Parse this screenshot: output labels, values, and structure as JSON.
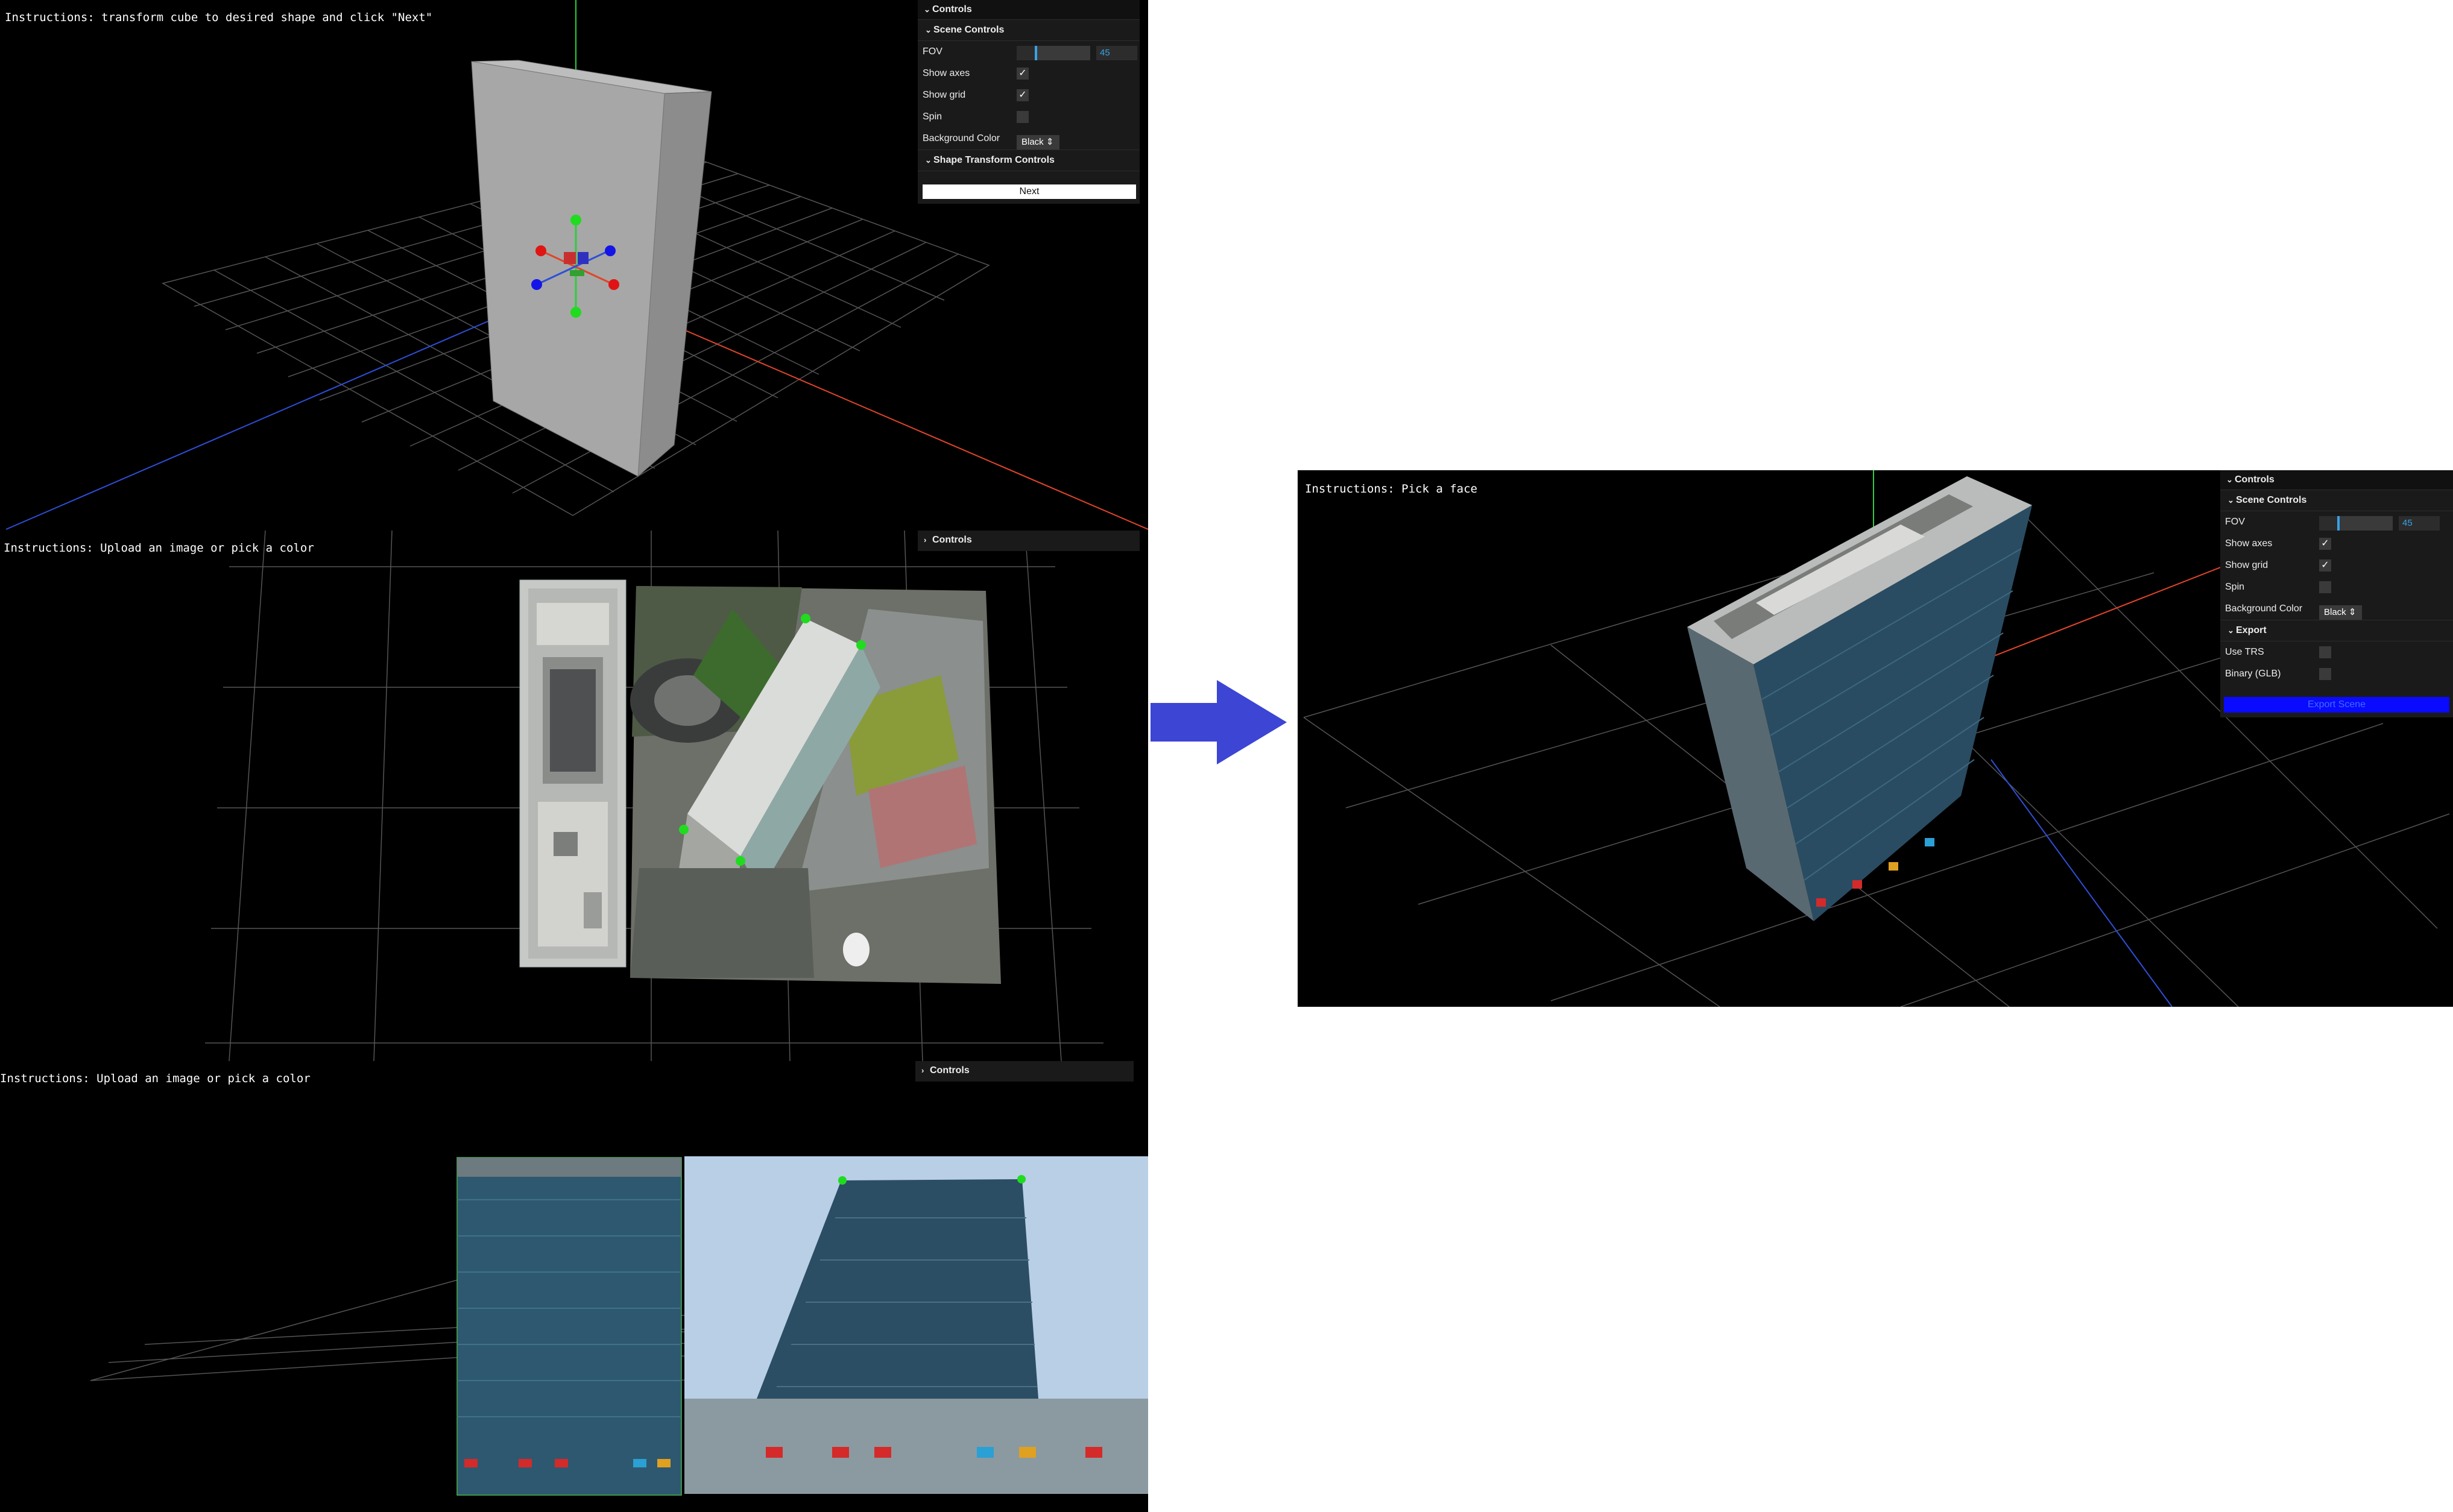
{
  "panels": {
    "transform": {
      "instructions": "Instructions: transform cube to desired shape and click \"Next\"",
      "controls": {
        "title": "Controls",
        "scene_title": "Scene Controls",
        "fov_label": "FOV",
        "fov_value": "45",
        "show_axes_label": "Show axes",
        "show_axes_checked": true,
        "show_grid_label": "Show grid",
        "show_grid_checked": true,
        "spin_label": "Spin",
        "spin_checked": false,
        "bg_label": "Background Color",
        "bg_value": "Black",
        "shape_title": "Shape Transform Controls",
        "next_label": "Next"
      }
    },
    "top_face": {
      "instructions": "Instructions: Upload an image or pick a color",
      "controls_title": "Controls"
    },
    "side_face": {
      "instructions": "Instructions: Upload an image or pick a color",
      "controls_title": "Controls"
    },
    "result": {
      "instructions": "Instructions: Pick a face",
      "controls": {
        "title": "Controls",
        "scene_title": "Scene Controls",
        "fov_label": "FOV",
        "fov_value": "45",
        "show_axes_label": "Show axes",
        "show_axes_checked": true,
        "show_grid_label": "Show grid",
        "show_grid_checked": true,
        "spin_label": "Spin",
        "spin_checked": false,
        "bg_label": "Background Color",
        "bg_value": "Black",
        "export_title": "Export",
        "use_trs_label": "Use TRS",
        "use_trs_checked": false,
        "binary_label": "Binary (GLB)",
        "binary_checked": false,
        "export_button_label": "Export Scene"
      }
    }
  },
  "icons": {
    "section_expanded": "chevron-down-icon",
    "section_collapsed": "chevron-right-icon",
    "checkbox_checked": "check-icon",
    "select_arrows": "updown-arrow-icon",
    "flow_arrow": "right-arrow-icon"
  },
  "colors": {
    "background": "#000000",
    "gui_bg": "#1a1a1a",
    "accent_blue": "#38a2e8",
    "axis_x": "#e0452a",
    "axis_y": "#2fcc40",
    "axis_z": "#2e4fd8",
    "flow_arrow": "#3c45d4",
    "export_button": "#0a0aff"
  }
}
